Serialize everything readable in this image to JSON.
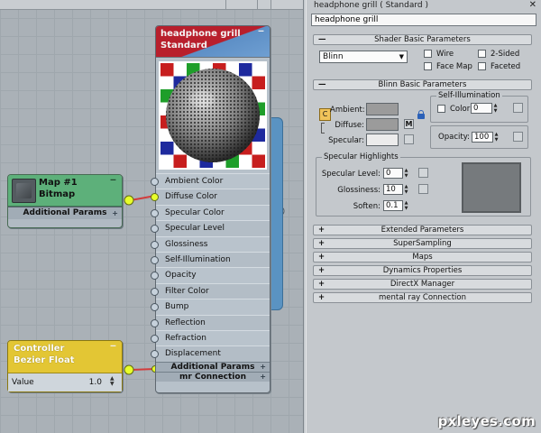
{
  "material_node": {
    "title_line1": "headphone grill",
    "title_line2": "Standard",
    "slots": [
      {
        "label": "Ambient Color",
        "connected": false
      },
      {
        "label": "Diffuse Color",
        "connected": true
      },
      {
        "label": "Specular Color",
        "connected": false
      },
      {
        "label": "Specular Level",
        "connected": false
      },
      {
        "label": "Glossiness",
        "connected": false
      },
      {
        "label": "Self-Illumination",
        "connected": false
      },
      {
        "label": "Opacity",
        "connected": false
      },
      {
        "label": "Filter Color",
        "connected": false
      },
      {
        "label": "Bump",
        "connected": false
      },
      {
        "label": "Reflection",
        "connected": false
      },
      {
        "label": "Refraction",
        "connected": false
      },
      {
        "label": "Displacement",
        "connected": false
      }
    ],
    "additional_params": "Additional Params",
    "mr_connection": "mr Connection"
  },
  "map_node": {
    "title_line1": "Map #1",
    "title_line2": "Bitmap",
    "additional_params": "Additional Params"
  },
  "controller_node": {
    "title_line1": "Controller",
    "title_line2": "Bezier Float",
    "value_label": "Value",
    "value": "1.0"
  },
  "panel": {
    "title": "headphone grill  ( Standard )",
    "name_field": "headphone grill",
    "shader_basic": {
      "header": "Shader Basic Parameters",
      "shader": "Blinn",
      "wire": "Wire",
      "two_sided": "2-Sided",
      "face_map": "Face Map",
      "faceted": "Faceted"
    },
    "blinn_basic": {
      "header": "Blinn Basic Parameters",
      "self_illum_group": "Self-Illumination",
      "ambient": "Ambient:",
      "diffuse": "Diffuse:",
      "specular": "Specular:",
      "color_label": "Color",
      "color_value": "0",
      "opacity_label": "Opacity:",
      "opacity_value": "100",
      "c_button": "C",
      "m_button": "M",
      "specular_highlights": "Specular Highlights",
      "specular_level_label": "Specular Level:",
      "specular_level_value": "0",
      "glossiness_label": "Glossiness:",
      "glossiness_value": "10",
      "soften_label": "Soften:",
      "soften_value": "0.1"
    },
    "collapsed_rollouts": [
      "Extended Parameters",
      "SuperSampling",
      "Maps",
      "Dynamics Properties",
      "DirectX Manager",
      "mental ray Connection"
    ],
    "expanded_sign": "—",
    "collapsed_sign": "+"
  },
  "watermark": "pxleyes.com",
  "colors": {
    "material_header_red": "#b81f2c",
    "material_header_blue": "#5d8fc6",
    "map_header_green": "#5db07a",
    "controller_header_yellow": "#e3c634",
    "connected_socket": "#e8ff2a",
    "wire_red": "#d23c3c"
  }
}
